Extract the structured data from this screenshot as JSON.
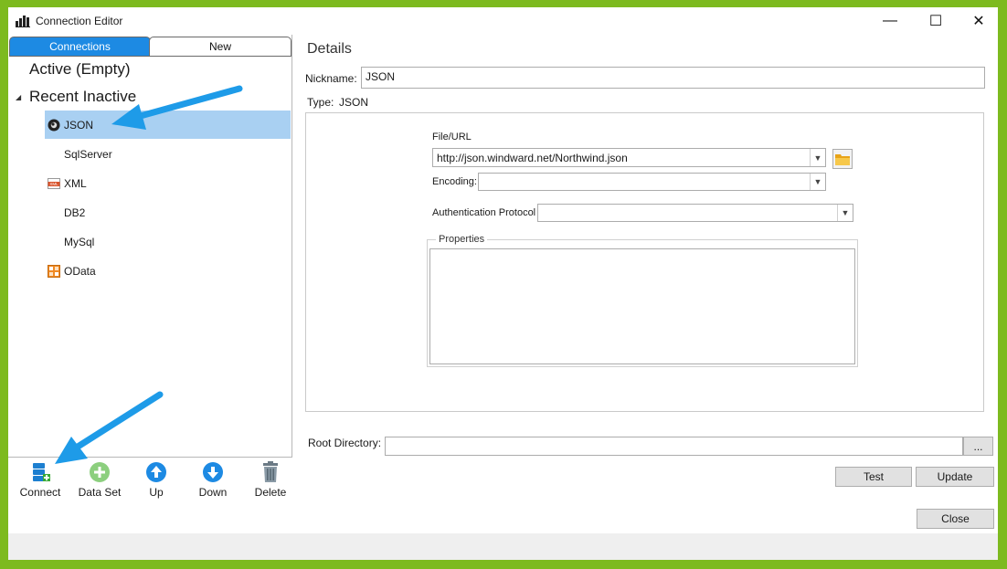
{
  "window": {
    "title": "Connection Editor",
    "app_icon": "bar-chart-icon"
  },
  "title_buttons": {
    "minimize": "—",
    "maximize": "☐",
    "close": "✕"
  },
  "tabs": [
    {
      "label": "Connections",
      "active": true
    },
    {
      "label": "New",
      "active": false
    }
  ],
  "tree": {
    "active_label": "Active (Empty)",
    "recent_label": "Recent Inactive",
    "items": [
      {
        "label": "JSON",
        "icon": "json-icon",
        "selected": true
      },
      {
        "label": "SqlServer",
        "icon": "",
        "selected": false
      },
      {
        "label": "XML",
        "icon": "xml-icon",
        "selected": false
      },
      {
        "label": "DB2",
        "icon": "",
        "selected": false
      },
      {
        "label": "MySql",
        "icon": "",
        "selected": false
      },
      {
        "label": "OData",
        "icon": "odata-icon",
        "selected": false
      }
    ]
  },
  "toolbar": [
    {
      "label": "Connect",
      "icon": "database-plus-icon"
    },
    {
      "label": "Data Set",
      "icon": "add-circle-icon"
    },
    {
      "label": "Up",
      "icon": "arrow-up-circle-icon"
    },
    {
      "label": "Down",
      "icon": "arrow-down-circle-icon"
    },
    {
      "label": "Delete",
      "icon": "trash-icon"
    }
  ],
  "details": {
    "title": "Details",
    "nickname_label": "Nickname:",
    "nickname_value": "JSON",
    "type_label": "Type:",
    "type_value": "JSON",
    "file_url_label": "File/URL",
    "file_url_value": "http://json.windward.net/Northwind.json",
    "encoding_label": "Encoding:",
    "encoding_value": "",
    "auth_label": "Authentication Protocol",
    "auth_value": "",
    "properties_label": "Properties",
    "root_dir_label": "Root Directory:",
    "root_dir_value": "",
    "browse_label": "..."
  },
  "buttons": {
    "test": "Test",
    "update": "Update",
    "close": "Close"
  },
  "colors": {
    "frame": "#7dba1f",
    "accent": "#1d8ae3",
    "selection": "#a9d0f2",
    "annotation_arrow": "#1e9be8"
  }
}
